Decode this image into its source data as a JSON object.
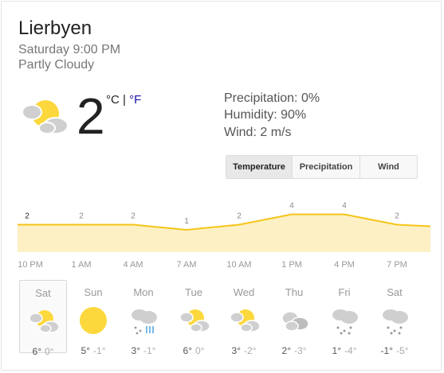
{
  "location": "Lierbyen",
  "datetime": "Saturday 9:00 PM",
  "condition": "Partly Cloudy",
  "current": {
    "temp": "2",
    "unit_c": "°C",
    "unit_sep": " | ",
    "unit_f": "°F",
    "icon": "partly-cloudy-icon"
  },
  "details": {
    "precipitation": "Precipitation: 0%",
    "humidity": "Humidity: 90%",
    "wind": "Wind: 2 m/s"
  },
  "tabs": [
    "Temperature",
    "Precipitation",
    "Wind"
  ],
  "colors": {
    "line": "#f5c518",
    "fill": "#fdf0c4",
    "sun": "#fcd83d",
    "cloud": "#cfcfcf",
    "rain": "#4aa3df"
  },
  "chart_data": {
    "type": "area",
    "x": [
      "10 PM",
      "1 AM",
      "4 AM",
      "7 AM",
      "10 AM",
      "1 PM",
      "4 PM",
      "7 PM"
    ],
    "values": [
      2,
      2,
      2,
      1,
      2,
      4,
      4,
      2
    ],
    "labels": [
      "2",
      "2",
      "2",
      "1",
      "2",
      "4",
      "4",
      "2"
    ]
  },
  "days": [
    {
      "name": "Sat",
      "icon": "partly-cloudy-icon",
      "hi": "6°",
      "lo": "0°"
    },
    {
      "name": "Sun",
      "icon": "sunny-icon",
      "hi": "5°",
      "lo": "-1°"
    },
    {
      "name": "Mon",
      "icon": "rain-snow-icon",
      "hi": "3°",
      "lo": "-1°"
    },
    {
      "name": "Tue",
      "icon": "partly-cloudy-icon",
      "hi": "6°",
      "lo": "0°"
    },
    {
      "name": "Wed",
      "icon": "partly-cloudy-icon",
      "hi": "3°",
      "lo": "-2°"
    },
    {
      "name": "Thu",
      "icon": "cloudy-icon",
      "hi": "2°",
      "lo": "-3°"
    },
    {
      "name": "Fri",
      "icon": "snow-icon",
      "hi": "1°",
      "lo": "-4°"
    },
    {
      "name": "Sat",
      "icon": "snow-icon",
      "hi": "-1°",
      "lo": "-5°"
    }
  ]
}
